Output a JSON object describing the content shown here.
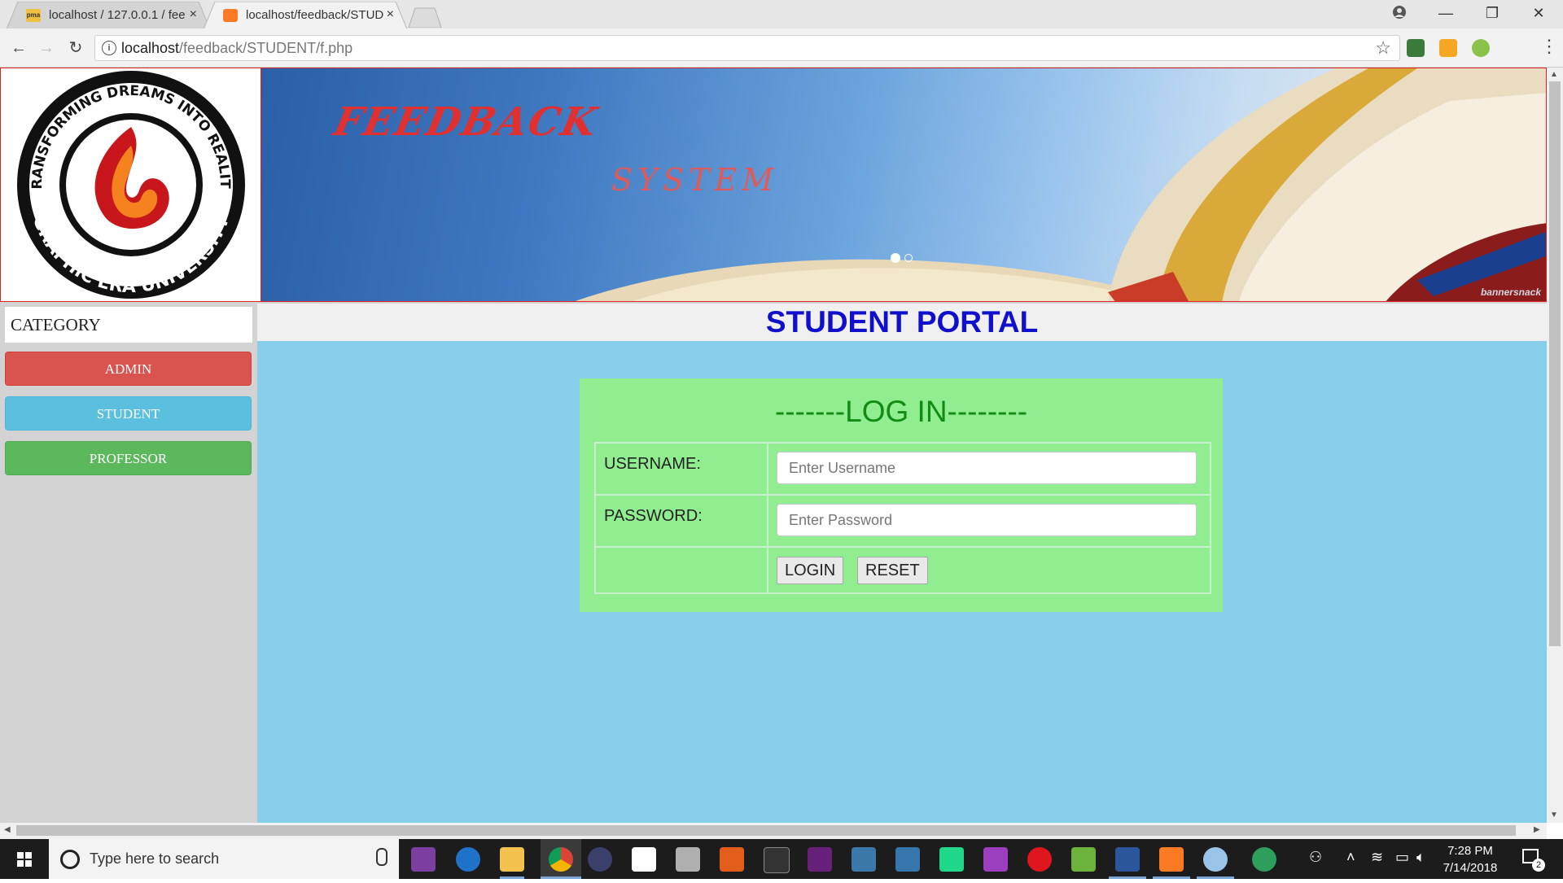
{
  "browser": {
    "tabs": [
      {
        "title": "localhost / 127.0.0.1 / fee",
        "close": "×",
        "active": false
      },
      {
        "title": "localhost/feedback/STUD",
        "close": "×",
        "active": true
      }
    ],
    "url_host": "localhost",
    "url_path": "/feedback/STUDENT/f.php",
    "window_controls": {
      "minimize": "—",
      "maximize": "❐",
      "close": "✕"
    }
  },
  "banner": {
    "logo_icon": "graphic-era-university-logo",
    "logo_text_top": "TRANSFORMING DREAMS INTO REALITY",
    "logo_text_bottom": "GRAPHIC ERA UNIVERSITY",
    "title_line1": "FEEDBACK",
    "title_line2": "SYSTEM",
    "watermark": "bannersnack"
  },
  "sidebar": {
    "heading": "CATEGORY",
    "buttons": [
      {
        "label": "ADMIN",
        "color": "#d9534f"
      },
      {
        "label": "STUDENT",
        "color": "#5bc0de"
      },
      {
        "label": "PROFESSOR",
        "color": "#5cb85c"
      }
    ]
  },
  "main": {
    "portal_title": "STUDENT PORTAL",
    "login": {
      "title": "-------LOG IN--------",
      "username_label": "USERNAME:",
      "username_placeholder": "Enter Username",
      "password_label": "PASSWORD:",
      "password_placeholder": "Enter Password",
      "login_button": "LOGIN",
      "reset_button": "RESET"
    }
  },
  "taskbar": {
    "search_placeholder": "Type here to search",
    "time": "7:28 PM",
    "date": "7/14/2018",
    "notification_count": "2"
  },
  "colors": {
    "main_bg": "#87ceeb",
    "login_bg": "#90ee90",
    "portal_title": "#1010cc",
    "login_title": "#138a13"
  }
}
